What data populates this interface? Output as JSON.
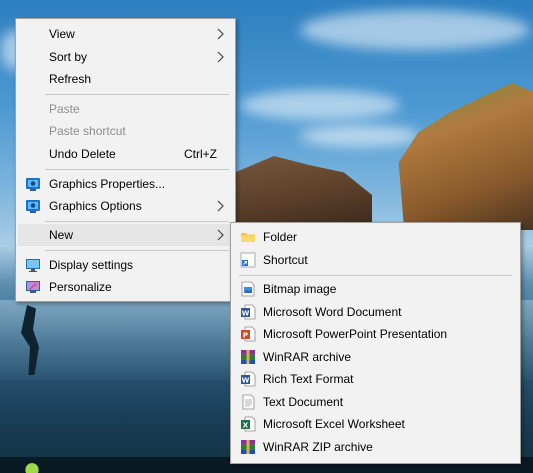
{
  "context_menu": {
    "items": [
      {
        "label": "View",
        "has_submenu": true
      },
      {
        "label": "Sort by",
        "has_submenu": true
      },
      {
        "label": "Refresh"
      },
      {
        "label": "Paste",
        "disabled": true
      },
      {
        "label": "Paste shortcut",
        "disabled": true
      },
      {
        "label": "Undo Delete",
        "shortcut": "Ctrl+Z"
      },
      {
        "label": "Graphics Properties...",
        "icon": "intel-graphics-icon"
      },
      {
        "label": "Graphics Options",
        "icon": "intel-graphics-icon",
        "has_submenu": true
      },
      {
        "label": "New",
        "has_submenu": true,
        "highlighted": true
      },
      {
        "label": "Display settings",
        "icon": "display-icon"
      },
      {
        "label": "Personalize",
        "icon": "personalize-icon"
      }
    ]
  },
  "new_submenu": {
    "items": [
      {
        "label": "Folder",
        "icon": "folder-icon"
      },
      {
        "label": "Shortcut",
        "icon": "shortcut-icon"
      },
      {
        "label": "Bitmap image",
        "icon": "bitmap-icon"
      },
      {
        "label": "Microsoft Word Document",
        "icon": "word-icon"
      },
      {
        "label": "Microsoft PowerPoint Presentation",
        "icon": "powerpoint-icon"
      },
      {
        "label": "WinRAR archive",
        "icon": "winrar-icon"
      },
      {
        "label": "Rich Text Format",
        "icon": "rtf-icon"
      },
      {
        "label": "Text Document",
        "icon": "text-document-icon"
      },
      {
        "label": "Microsoft Excel Worksheet",
        "icon": "excel-icon"
      },
      {
        "label": "WinRAR ZIP archive",
        "icon": "winrar-zip-icon"
      }
    ]
  },
  "colors": {
    "menu_background": "#f2f2f2",
    "menu_highlight": "#e5e5e5",
    "disabled_text": "#8e8e8e"
  }
}
